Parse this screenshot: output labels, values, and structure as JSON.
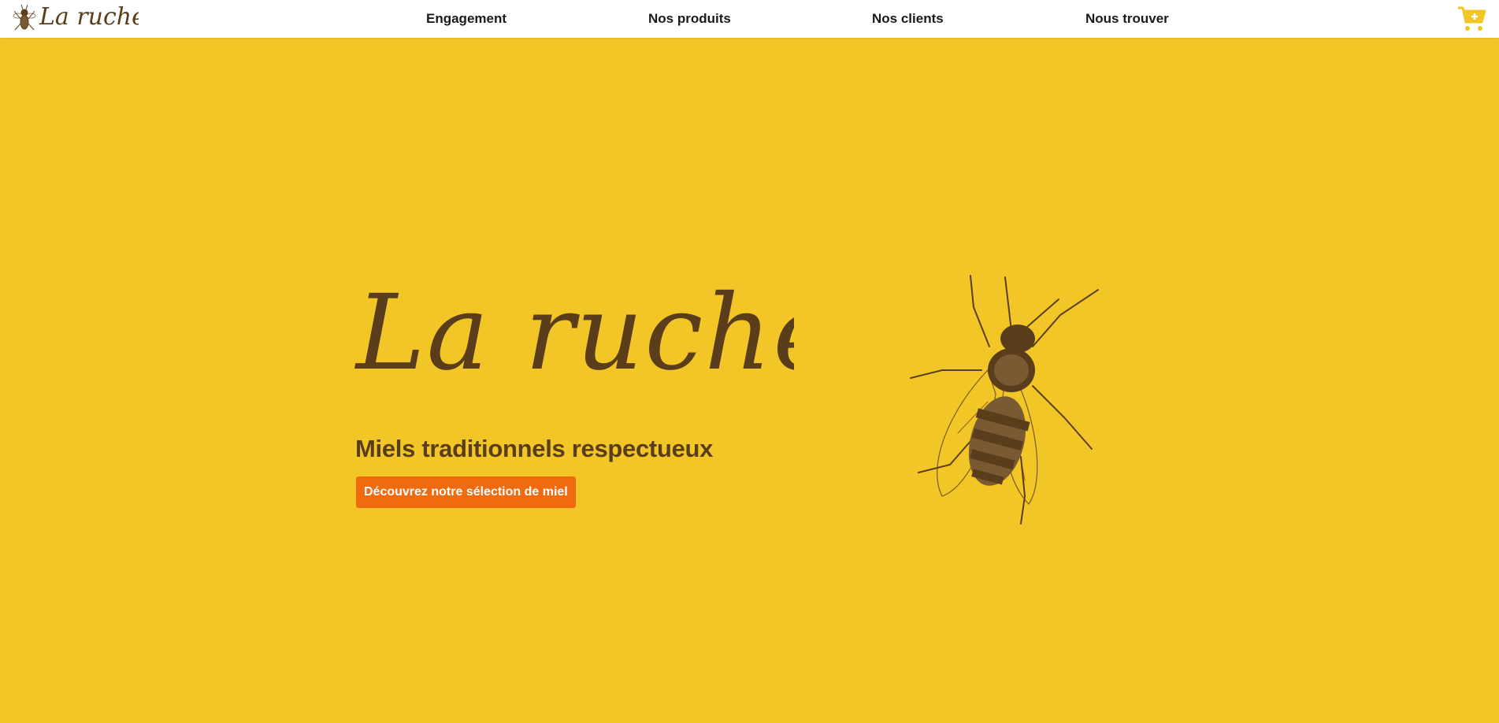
{
  "header": {
    "brand_name": "La ruche",
    "nav": [
      {
        "label": "Engagement"
      },
      {
        "label": "Nos produits"
      },
      {
        "label": "Nos clients"
      },
      {
        "label": "Nous trouver"
      }
    ],
    "cart_icon": "cart-plus-icon"
  },
  "hero": {
    "logo_text": "La ruche",
    "subtitle": "Miels traditionnels respectueux",
    "cta_label": "Découvrez notre sélection de miel",
    "illustration": "bee-engraving"
  },
  "colors": {
    "background": "#f3c627",
    "header_bg": "#ffffff",
    "brown": "#5a3e1b",
    "cta_bg": "#f06a10",
    "cart": "#f3c627"
  }
}
